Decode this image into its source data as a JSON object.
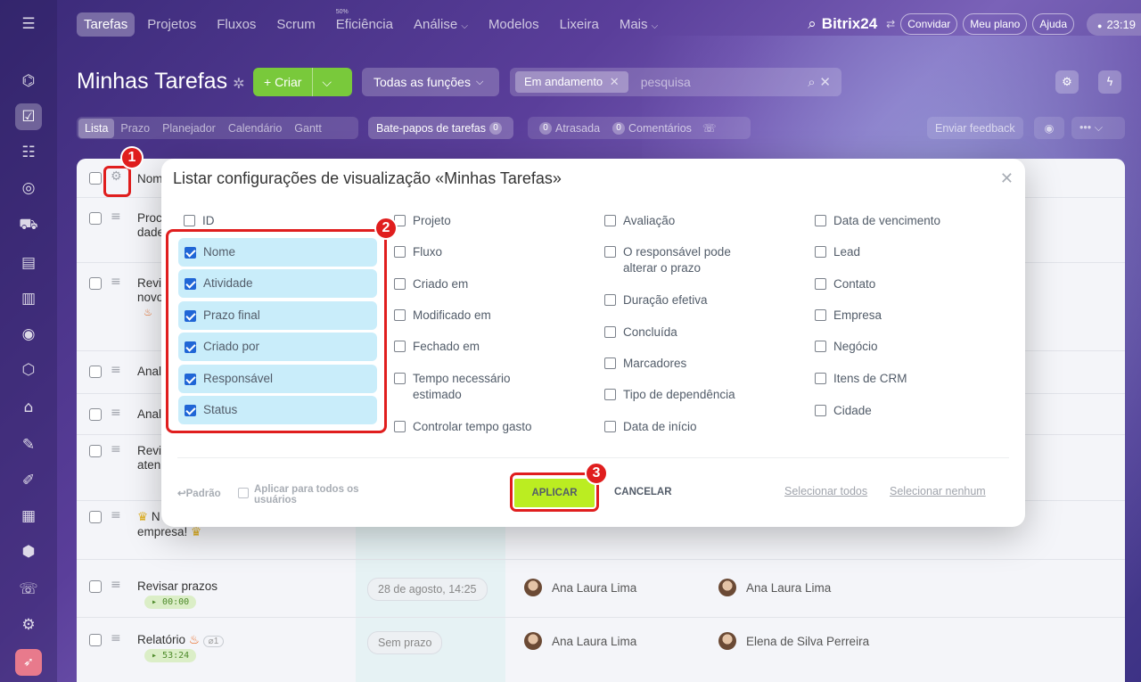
{
  "top_nav": {
    "items": [
      "Tarefas",
      "Projetos",
      "Fluxos",
      "Scrum",
      "Eficiência",
      "Análise",
      "Modelos",
      "Lixeira",
      "Mais"
    ],
    "efficiency_percent": "50%",
    "brand": "Bitrix24",
    "invite": "Convidar",
    "plan": "Meu plano",
    "help": "Ajuda",
    "clock": "23:19"
  },
  "header": {
    "title": "Minhas Tarefas",
    "create": "+ Criar",
    "roles": "Todas as funções",
    "filter_chip": "Em andamento",
    "search_placeholder": "pesquisa"
  },
  "views": {
    "tabs": [
      "Lista",
      "Prazo",
      "Planejador",
      "Calendário",
      "Gantt"
    ],
    "chats": "Bate-papos de tarefas",
    "chats_count": "0",
    "overdue_count": "0",
    "overdue": "Atrasada",
    "comments_count": "0",
    "comments": "Comentários",
    "feedback": "Enviar feedback"
  },
  "list": {
    "header_name": "Nome",
    "rows": [
      {
        "name": "Proc",
        "name2": "dade"
      },
      {
        "name": "Revi",
        "name2": "novo"
      },
      {
        "name": "Anal"
      },
      {
        "name": "Anal"
      },
      {
        "name": "Revi",
        "name2": "aten"
      },
      {
        "name": "N",
        "name2": "empresa!"
      },
      {
        "name": "Revisar prazos",
        "timer": "00:00",
        "deadline": "28 de agosto, 14:25",
        "responsible": "Ana Laura Lima",
        "creator": "Ana Laura Lima"
      },
      {
        "name": "Relatório",
        "attach": "1",
        "timer": "53:24",
        "deadline": "Sem prazo",
        "responsible": "Ana Laura Lima",
        "creator": "Elena de Silva Perreira"
      }
    ]
  },
  "modal": {
    "title": "Listar configurações de visualização «Minhas Tarefas»",
    "col1": [
      {
        "label": "ID",
        "checked": false
      },
      {
        "label": "Nome",
        "checked": true
      },
      {
        "label": "Atividade",
        "checked": true
      },
      {
        "label": "Prazo final",
        "checked": true
      },
      {
        "label": "Criado por",
        "checked": true
      },
      {
        "label": "Responsável",
        "checked": true
      },
      {
        "label": "Status",
        "checked": true
      }
    ],
    "col2": [
      "Projeto",
      "Fluxo",
      "Criado em",
      "Modificado em",
      "Fechado em",
      "Tempo necessário estimado",
      "Controlar tempo gasto"
    ],
    "col3": [
      "Avaliação",
      "O responsável pode alterar o prazo",
      "Duração efetiva",
      "Concluída",
      "Marcadores",
      "Tipo de dependência",
      "Data de início"
    ],
    "col4": [
      "Data de vencimento",
      "Lead",
      "Contato",
      "Empresa",
      "Negócio",
      "Itens de CRM",
      "Cidade"
    ],
    "reset": "Padrão",
    "apply_all": "Aplicar para todos os usuários",
    "apply": "APLICAR",
    "cancel": "CANCELAR",
    "select_all": "Selecionar todos",
    "select_none": "Selecionar nenhum"
  },
  "annotations": [
    "1",
    "2",
    "3"
  ],
  "colors": {
    "accent_green": "#79c93b",
    "apply_green": "#bbed21",
    "highlight_red": "#e01e1e",
    "checked_bg": "#c9edfa",
    "checkbox_blue": "#2066d6"
  }
}
